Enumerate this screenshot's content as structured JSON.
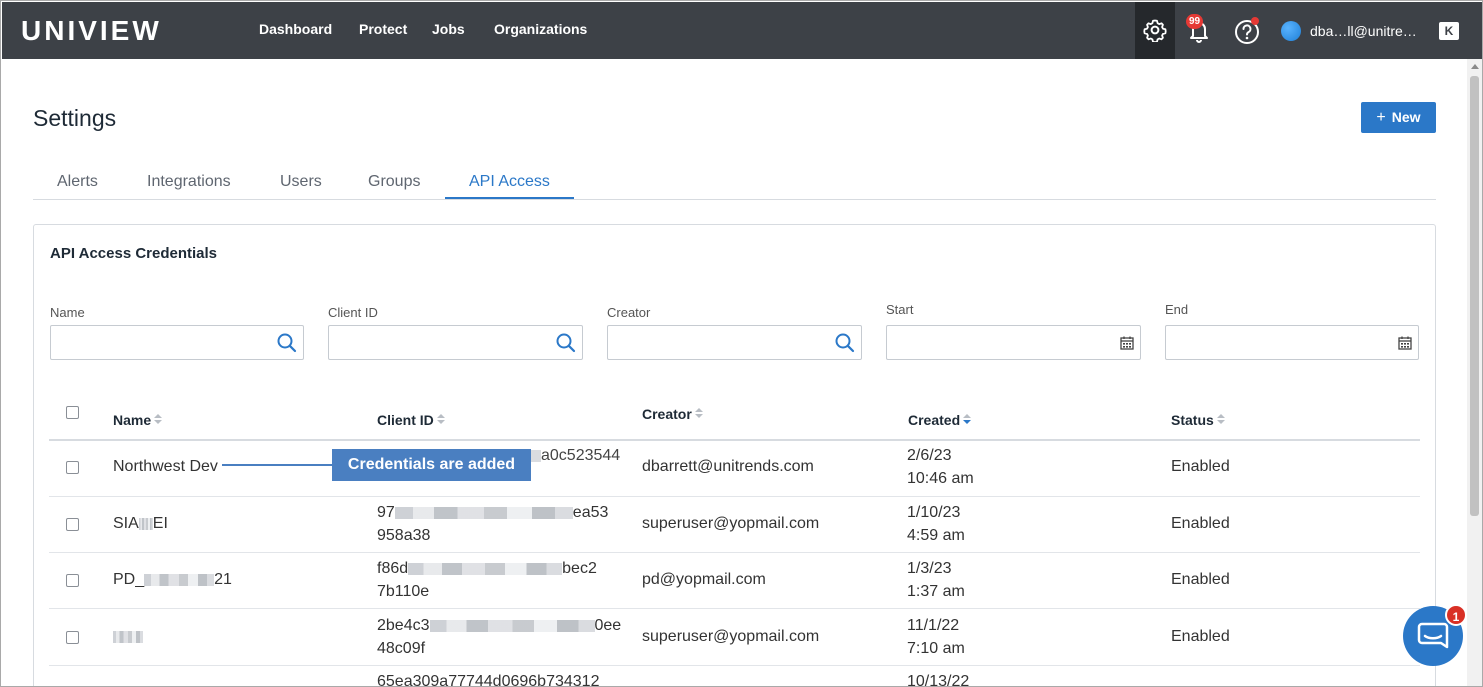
{
  "brand": {
    "logo_text": "UNIVIEW"
  },
  "nav": [
    {
      "label": "Dashboard"
    },
    {
      "label": "Protect"
    },
    {
      "label": "Jobs"
    },
    {
      "label": "Organizations"
    }
  ],
  "header": {
    "notifications_badge": "99",
    "username": "dba…ll@unitre…"
  },
  "page": {
    "title": "Settings",
    "new_button": "New"
  },
  "tabs": [
    {
      "label": "Alerts"
    },
    {
      "label": "Integrations"
    },
    {
      "label": "Users"
    },
    {
      "label": "Groups"
    },
    {
      "label": "API Access",
      "active": true
    }
  ],
  "card": {
    "title": "API Access Credentials"
  },
  "filters": {
    "name_label": "Name",
    "client_id_label": "Client ID",
    "creator_label": "Creator",
    "start_label": "Start",
    "end_label": "End"
  },
  "table": {
    "columns": {
      "name": "Name",
      "client_id": "Client ID",
      "creator": "Creator",
      "created": "Created",
      "status": "Status"
    },
    "sort_column": "Created",
    "rows": [
      {
        "name": "Northwest Dev",
        "client_id_1": "a0c523544",
        "client_id_2": "",
        "creator": "dbarrett@unitrends.com",
        "date": "2/6/23",
        "time": "10:46 am",
        "status": "Enabled"
      },
      {
        "name": "SIA",
        "name_tail": "EI",
        "client_id_1": "97",
        "client_id_1_tail": "ea53",
        "client_id_2": "958a38",
        "creator": "superuser@yopmail.com",
        "date": "1/10/23",
        "time": "4:59 am",
        "status": "Enabled"
      },
      {
        "name": "PD_",
        "name_tail": "21",
        "client_id_1": "f86d",
        "client_id_1_tail": "bec2",
        "client_id_2": "7b110e",
        "creator": "pd@yopmail.com",
        "date": "1/3/23",
        "time": "1:37 am",
        "status": "Enabled"
      },
      {
        "name": "",
        "client_id_1": "2be4c3",
        "client_id_1_tail": "0ee",
        "client_id_2": "48c09f",
        "creator": "superuser@yopmail.com",
        "date": "11/1/22",
        "time": "7:10 am",
        "status": "Enabled"
      },
      {
        "name": "",
        "client_id_1": "65ea309a77744d0696b734312",
        "client_id_2": "",
        "creator": "",
        "date": "10/13/22",
        "time": "",
        "status": ""
      }
    ]
  },
  "callout": {
    "text": "Credentials are added"
  },
  "chat": {
    "badge": "1"
  },
  "colors": {
    "accent": "#2b78c8",
    "topbar": "#3d4147",
    "callout": "#4a7fc1",
    "badge": "#e53935"
  }
}
